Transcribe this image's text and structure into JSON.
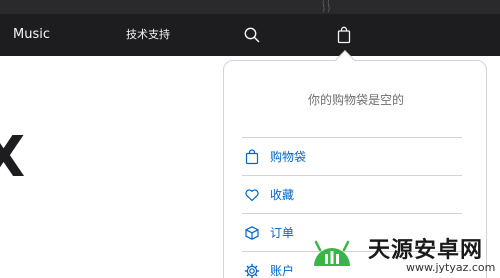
{
  "nav": {
    "music_label": "Music",
    "support_label": "技术支持",
    "search_icon": "search-icon",
    "bag_icon": "shopping-bag-icon"
  },
  "bag_dropdown": {
    "empty_message": "你的购物袋是空的",
    "items": [
      {
        "label": "购物袋",
        "icon": "shopping-bag-icon"
      },
      {
        "label": "收藏",
        "icon": "heart-icon"
      },
      {
        "label": "订单",
        "icon": "box-icon"
      },
      {
        "label": "账户",
        "icon": "gear-icon"
      }
    ]
  },
  "watermark": {
    "title": "天源安卓网",
    "url": "www.jytyaz.com"
  },
  "colors": {
    "nav_bg": "#1d1d1f",
    "nav_text": "#f5f5f7",
    "link": "#0066cc",
    "muted": "#6e6e73",
    "divider": "#d2d2d7",
    "watermark_green": "#3ab54a"
  }
}
